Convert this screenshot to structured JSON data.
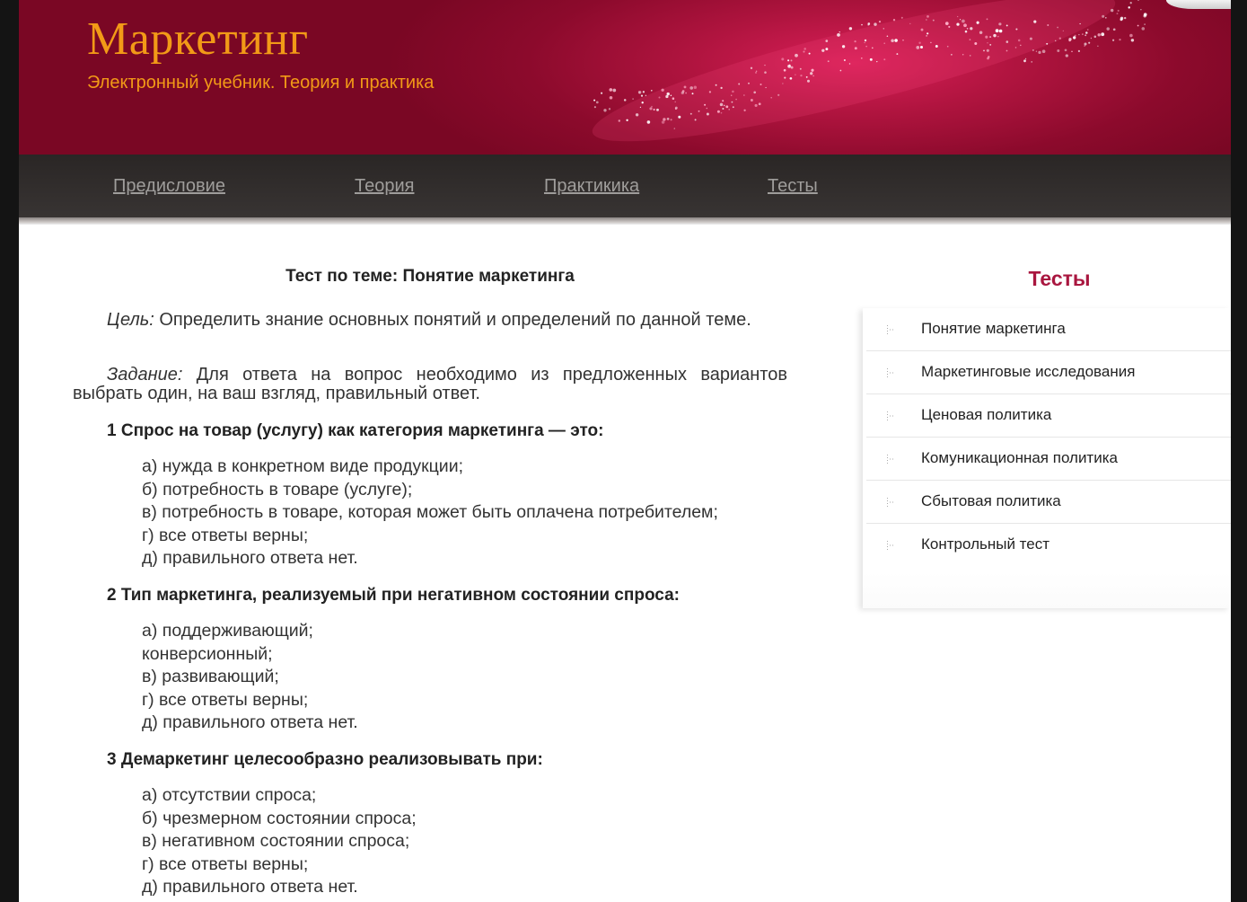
{
  "header": {
    "title": "Маркетинг",
    "subtitle": "Электронный учебник. Теория и практика"
  },
  "nav": {
    "items": [
      {
        "label": "Предисловие"
      },
      {
        "label": "Теория"
      },
      {
        "label": "Практикика"
      },
      {
        "label": "Тесты"
      }
    ]
  },
  "main": {
    "test_title": "Тест по теме: Понятие маркетинга",
    "goal_label": "Цель:",
    "goal_text": " Определить знание основных понятий и определений по данной теме.",
    "task_label": "Задание:",
    "task_text": " Для ответа на вопрос необходимо из предложенных вариантов выбрать один, на ваш взгляд, правильный ответ.",
    "questions": [
      {
        "text": "1 Спрос на товар (услугу) как категория маркетинга — это:",
        "options": [
          "а) нужда в конкретном виде продукции;",
          "б) потребность в товаре (услуге);",
          "в) потребность в товаре, которая может быть оплачена потребителем;",
          "г) все ответы верны;",
          "д) правильного ответа нет."
        ]
      },
      {
        "text": "2 Тип маркетинга, реализуемый при негативном состоянии спроса:",
        "options": [
          "а) поддерживающий;",
          "конверсионный;",
          "в) развивающий;",
          "г) все ответы верны;",
          "д) правильного ответа нет."
        ]
      },
      {
        "text": "3 Демаркетинг целесообразно реализовывать при:",
        "options": [
          "а) отсутствии спроса;",
          "б) чрезмерном состоянии спроса;",
          "в) негативном состоянии спроса;",
          "г) все ответы верны;",
          "д) правильного ответа нет."
        ]
      }
    ]
  },
  "sidebar": {
    "title": "Тесты",
    "items": [
      {
        "label": "Понятие маркетинга"
      },
      {
        "label": "Маркетинговые исследования"
      },
      {
        "label": "Ценовая политика"
      },
      {
        "label": "Комуникационная политика"
      },
      {
        "label": "Сбытовая политика"
      },
      {
        "label": "Контрольный тест"
      }
    ]
  },
  "colors": {
    "header_bg": "#8c0a2c",
    "title_orange": "#f29a17",
    "nav_bg": "#2f2b2a",
    "nav_link": "#9f9d9b",
    "sidebar_title": "#a9163f"
  }
}
